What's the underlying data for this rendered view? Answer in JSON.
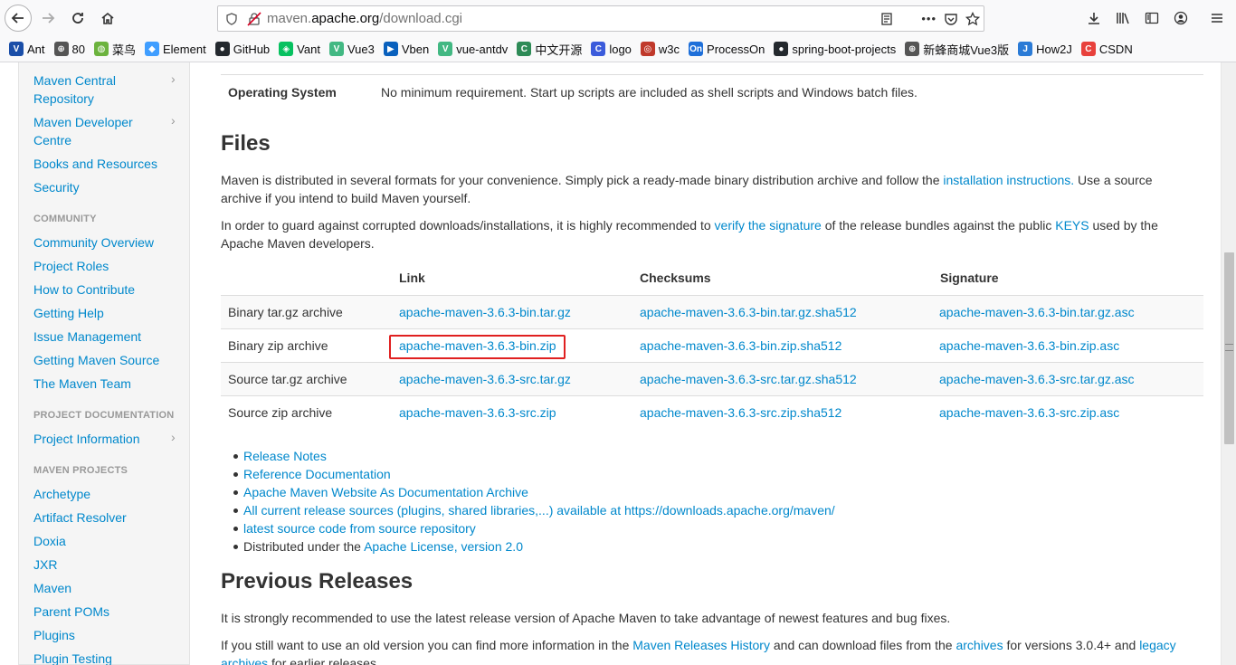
{
  "browser": {
    "url_prefix": "maven.",
    "url_domain": "apache.org",
    "url_path": "/download.cgi",
    "more_label": "•••"
  },
  "bookmarks": [
    {
      "label": "Ant",
      "color": "#1a4ea8",
      "glyph": "V"
    },
    {
      "label": "80",
      "color": "#555555",
      "glyph": "⊕"
    },
    {
      "label": "菜鸟",
      "color": "#6cb33e",
      "glyph": "◍"
    },
    {
      "label": "Element",
      "color": "#409eff",
      "glyph": "◆"
    },
    {
      "label": "GitHub",
      "color": "#24292e",
      "glyph": "●"
    },
    {
      "label": "Vant",
      "color": "#07c160",
      "glyph": "◈"
    },
    {
      "label": "Vue3",
      "color": "#42b883",
      "glyph": "V"
    },
    {
      "label": "Vben",
      "color": "#0960bd",
      "glyph": "▶"
    },
    {
      "label": "vue-antdv",
      "color": "#42b883",
      "glyph": "V"
    },
    {
      "label": "中文开源",
      "color": "#2e8b57",
      "glyph": "C"
    },
    {
      "label": "logo",
      "color": "#3b5bdb",
      "glyph": "C"
    },
    {
      "label": "w3c",
      "color": "#c0392b",
      "glyph": "◎"
    },
    {
      "label": "ProcessOn",
      "color": "#1e6fd9",
      "glyph": "On"
    },
    {
      "label": "spring-boot-projects",
      "color": "#24292e",
      "glyph": "●"
    },
    {
      "label": "新蜂商城Vue3版",
      "color": "#555555",
      "glyph": "⊕"
    },
    {
      "label": "How2J",
      "color": "#2b7bd6",
      "glyph": "J"
    },
    {
      "label": "CSDN",
      "color": "#e8413c",
      "glyph": "C"
    }
  ],
  "sidebar": {
    "items_top": [
      {
        "label1": "Maven Central",
        "label2": "Repository",
        "chevron": "›"
      },
      {
        "label1": "Maven Developer",
        "label2": "Centre",
        "chevron": "›"
      },
      {
        "label1": "Books and Resources"
      },
      {
        "label1": "Security"
      }
    ],
    "community_header": "COMMUNITY",
    "community": [
      "Community Overview",
      "Project Roles",
      "How to Contribute",
      "Getting Help",
      "Issue Management",
      "Getting Maven Source",
      "The Maven Team"
    ],
    "projdoc_header": "PROJECT DOCUMENTATION",
    "projdoc": [
      {
        "label": "Project Information",
        "chevron": "›"
      }
    ],
    "projects_header": "MAVEN PROJECTS",
    "projects": [
      "Archetype",
      "Artifact Resolver",
      "Doxia",
      "JXR",
      "Maven",
      "Parent POMs",
      "Plugins",
      "Plugin Testing"
    ]
  },
  "main": {
    "os_label": "Operating System",
    "os_value": "No minimum requirement. Start up scripts are included as shell scripts and Windows batch files.",
    "files_title": "Files",
    "p1_a": "Maven is distributed in several formats for your convenience. Simply pick a ready-made binary distribution archive and follow the ",
    "p1_link": "installation instructions.",
    "p1_b": " Use a source",
    "p1_c": "archive if you intend to build Maven yourself.",
    "p2_a": "In order to guard against corrupted downloads/installations, it is highly recommended to ",
    "p2_link1": "verify the signature",
    "p2_b": " of the release bundles against the public ",
    "p2_link2": "KEYS",
    "p2_c": " used by the",
    "p2_d": "Apache Maven developers.",
    "table_headers": [
      "Link",
      "Checksums",
      "Signature"
    ],
    "rows": [
      {
        "type": "Binary tar.gz archive",
        "link": "apache-maven-3.6.3-bin.tar.gz",
        "checksum": "apache-maven-3.6.3-bin.tar.gz.sha512",
        "signature": "apache-maven-3.6.3-bin.tar.gz.asc"
      },
      {
        "type": "Binary zip archive",
        "link": "apache-maven-3.6.3-bin.zip",
        "checksum": "apache-maven-3.6.3-bin.zip.sha512",
        "signature": "apache-maven-3.6.3-bin.zip.asc"
      },
      {
        "type": "Source tar.gz archive",
        "link": "apache-maven-3.6.3-src.tar.gz",
        "checksum": "apache-maven-3.6.3-src.tar.gz.sha512",
        "signature": "apache-maven-3.6.3-src.tar.gz.asc"
      },
      {
        "type": "Source zip archive",
        "link": "apache-maven-3.6.3-src.zip",
        "checksum": "apache-maven-3.6.3-src.zip.sha512",
        "signature": "apache-maven-3.6.3-src.zip.asc"
      }
    ],
    "bullets": {
      "b1": "Release Notes",
      "b2": "Reference Documentation",
      "b3": "Apache Maven Website As Documentation Archive",
      "b4": "All current release sources (plugins, shared libraries,...) available at https://downloads.apache.org/maven/",
      "b5": "latest source code from source repository",
      "b6_text": "Distributed under the ",
      "b6_link": "Apache License, version 2.0"
    },
    "prev_title": "Previous Releases",
    "p3": "It is strongly recommended to use the latest release version of Apache Maven to take advantage of newest features and bug fixes.",
    "p4_a": "If you still want to use an old version you can find more information in the ",
    "p4_link1": "Maven Releases History",
    "p4_b": " and can download files from the ",
    "p4_link2": "archives",
    "p4_c": " for versions 3.0.4+ and ",
    "p4_link3": "legacy",
    "p4_link4": "archives",
    "p4_d": " for earlier releases."
  }
}
